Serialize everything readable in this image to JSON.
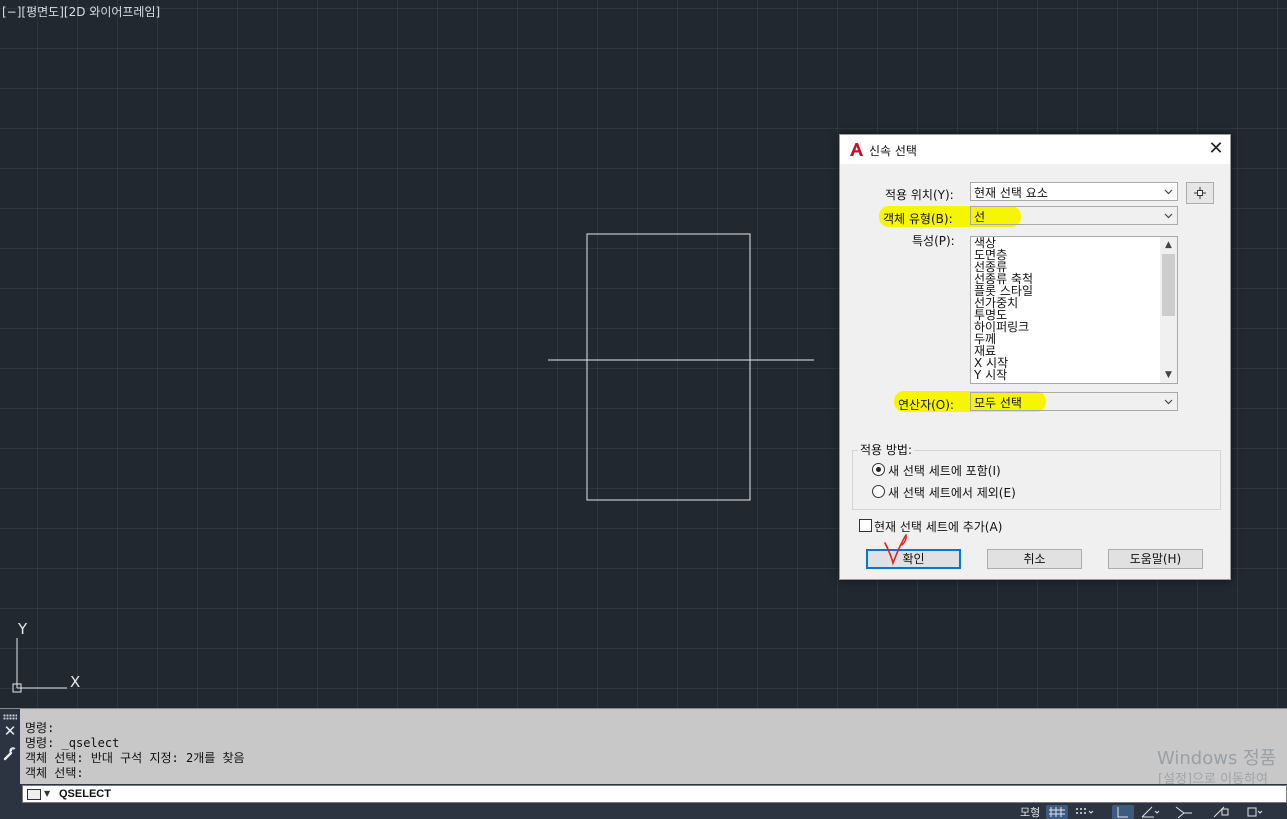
{
  "viewport": {
    "label": "[−][평면도][2D 와이어프레임]"
  },
  "ucs": {
    "y_label": "Y",
    "x_label": "X"
  },
  "dialog": {
    "title": "신속 선택",
    "apply_to_label": "적용 위치(Y):",
    "apply_to_value": "현재 선택 요소",
    "object_type_label": "객체 유형(B):",
    "object_type_value": "선",
    "properties_label": "특성(P):",
    "properties": [
      "색상",
      "도면층",
      "선종류",
      "선종류 축척",
      "플롯 스타일",
      "선가중치",
      "투명도",
      "하이퍼링크",
      "두께",
      "재료",
      "X 시작",
      "Y 시작"
    ],
    "operator_label": "연산자(O):",
    "operator_value": "모두 선택",
    "how_to_apply_label": "적용 방법:",
    "include_option": "새 선택 세트에 포함(I)",
    "exclude_option": "새 선택 세트에서 제외(E)",
    "include_selected": true,
    "append_label": "현재 선택 세트에 추가(A)",
    "append_checked": false,
    "ok_label": "확인",
    "cancel_label": "취소",
    "help_label": "도움말(H)",
    "highlight_color": "#f6f600",
    "check_annotation_color": "#e0202a"
  },
  "command": {
    "history": [
      "명령:",
      "명령: _qselect",
      "객체 선택: 반대 구석 지정: 2개를 찾음",
      "객체 선택:"
    ],
    "current_input": "QSELECT"
  },
  "watermark": {
    "line1": "Windows 정품",
    "line2": "[설정]으로 이동하여"
  },
  "status_bar": {
    "model_label": "모형"
  },
  "colors": {
    "canvas_bg": "#212830",
    "accent": "#0078d7"
  }
}
